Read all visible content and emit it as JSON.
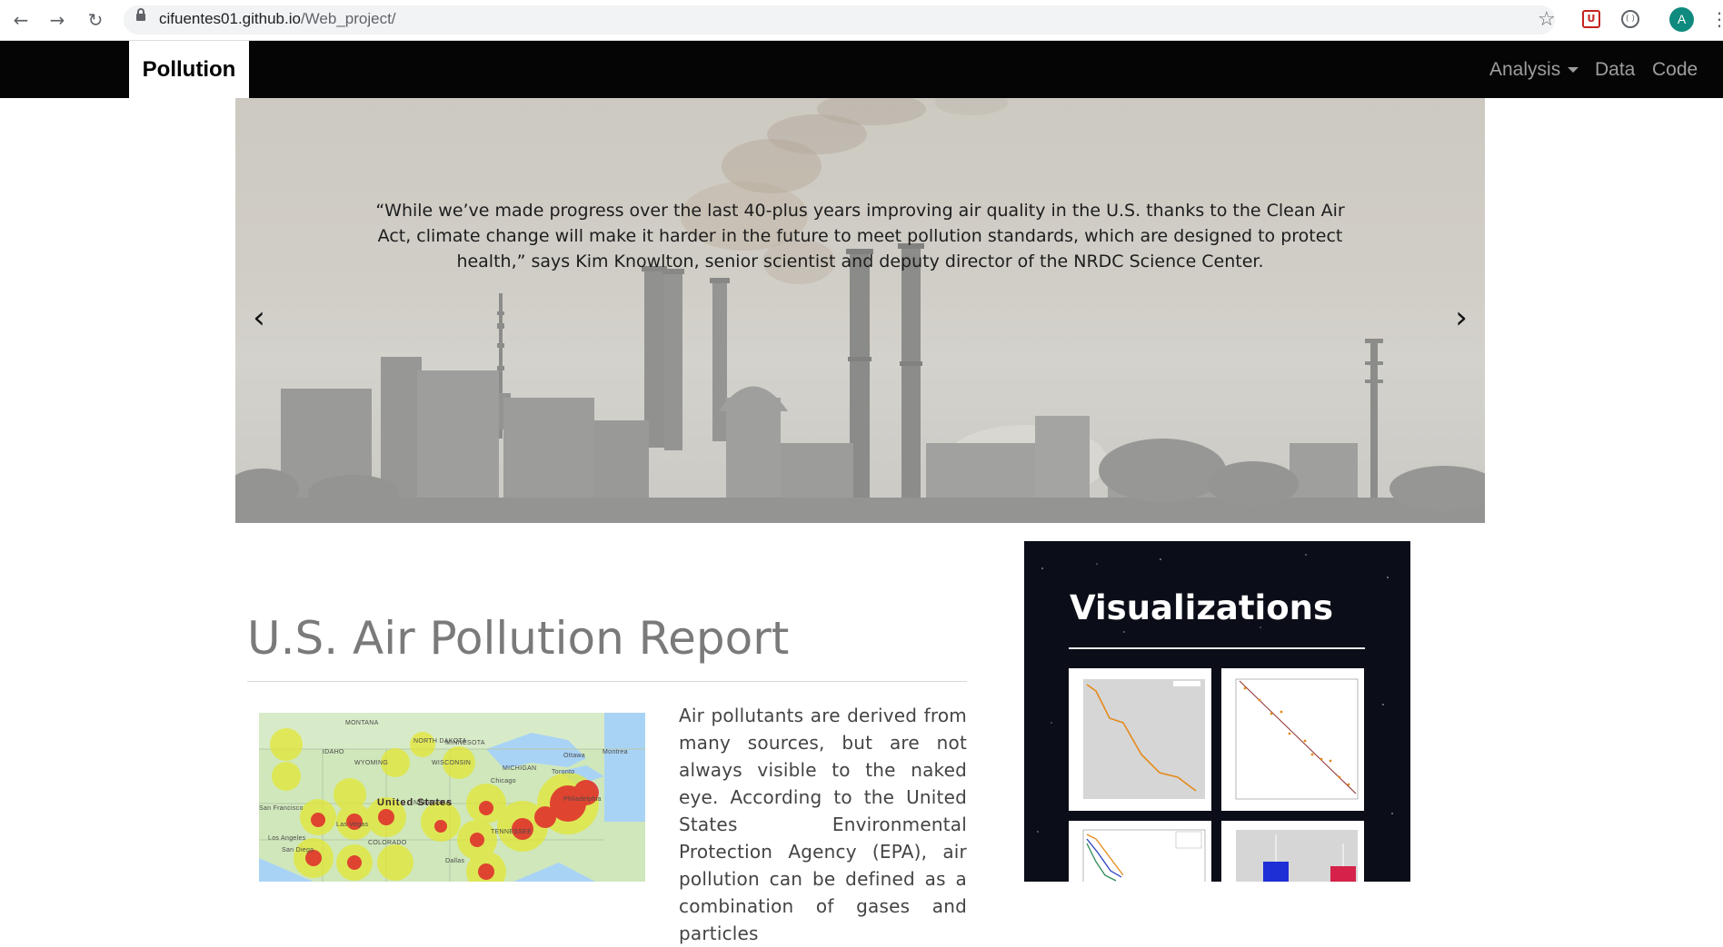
{
  "browser": {
    "url_host": "cifuentes01.github.io",
    "url_path": "/Web_project/",
    "profile_initial": "A",
    "back_glyph": "←",
    "forward_glyph": "→",
    "reload_glyph": "↻",
    "star_glyph": "☆",
    "kebab_glyph": "⋮",
    "ext1_glyph": "U",
    "ext2_glyph": "( )"
  },
  "navbar": {
    "brand": "Pollution",
    "links": [
      "Analysis",
      "Data",
      "Code"
    ]
  },
  "carousel": {
    "quote": "“While we’ve made progress over the last 40-plus years improving air quality in the U.S. thanks to the Clean Air Act, climate change will make it harder in the future to meet pollution standards, which are designed to protect health,” says Kim Knowlton, senior scientist and deputy director of the NRDC Science Center.",
    "prev_glyph": "‹",
    "next_glyph": "›"
  },
  "report": {
    "title": "U.S. Air Pollution Report",
    "body": "Air pollutants are derived from many sources, but are not always visible to the naked eye. According to the United States Environmental Protection Agency (EPA), air pollution can be defined as a combination of gases and particles"
  },
  "map": {
    "labels": [
      "MONTANA",
      "NORTH DAKOTA",
      "MINNESOTA",
      "IDAHO",
      "WYOMING",
      "WISCONSIN",
      "MICHIGAN",
      "Ottawa",
      "Montrea",
      "Toronto",
      "NEBRASKA",
      "Chicago",
      "United States",
      "San Francisco",
      "Las Vegas",
      "Los Angeles",
      "San Diego",
      "Dallas",
      "Philadelphia",
      "TENNESSEE",
      "COLORADO"
    ]
  },
  "visualizations": {
    "title": "Visualizations",
    "thumbnails": [
      "line-trend-chart",
      "scatter-regression-chart",
      "multi-line-chart",
      "bar-chart"
    ]
  },
  "colors": {
    "navbar_bg": "#050505",
    "nav_link": "#9d9d9d",
    "title_gray": "#7a7a7a",
    "viz_bg": "#0b0e18",
    "heat_red": "#e0282a",
    "heat_yellow": "#e6e62a"
  }
}
